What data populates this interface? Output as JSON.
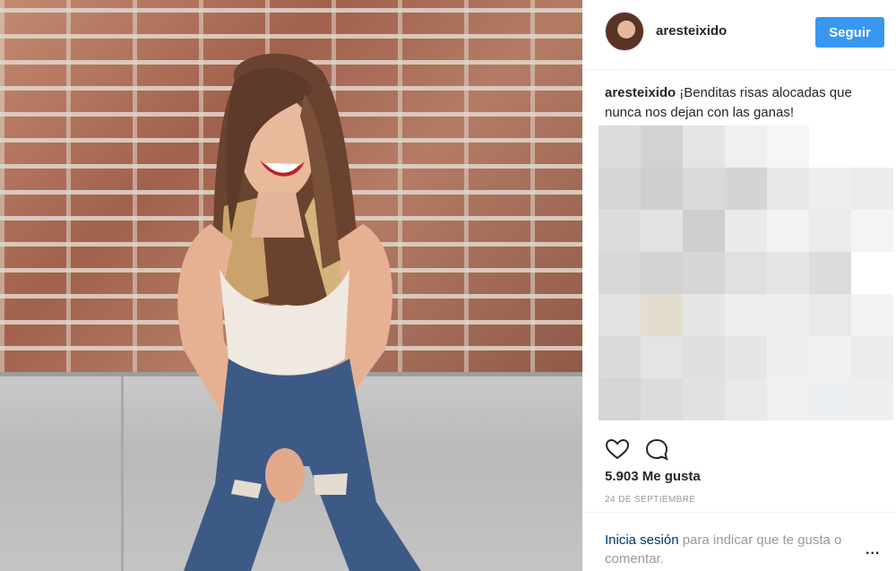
{
  "post": {
    "username": "aresteixido",
    "follow_label": "Seguir",
    "caption_user": "aresteixido",
    "caption_text": "¡Benditas risas alocadas que nunca nos dejan con las ganas!",
    "likes": "5.903 Me gusta",
    "date": "24 DE SEPTIEMBRE",
    "login_link": "Inicia sesión",
    "login_rest": " para indicar que te gusta o comentar.",
    "more_label": "..."
  },
  "icons": {
    "like": "heart-icon",
    "comment": "comment-bubble-icon",
    "more": "more-options-icon"
  },
  "colors": {
    "follow_button": "#3897f0",
    "link": "#003569",
    "muted_text": "#999999",
    "text": "#262626"
  }
}
